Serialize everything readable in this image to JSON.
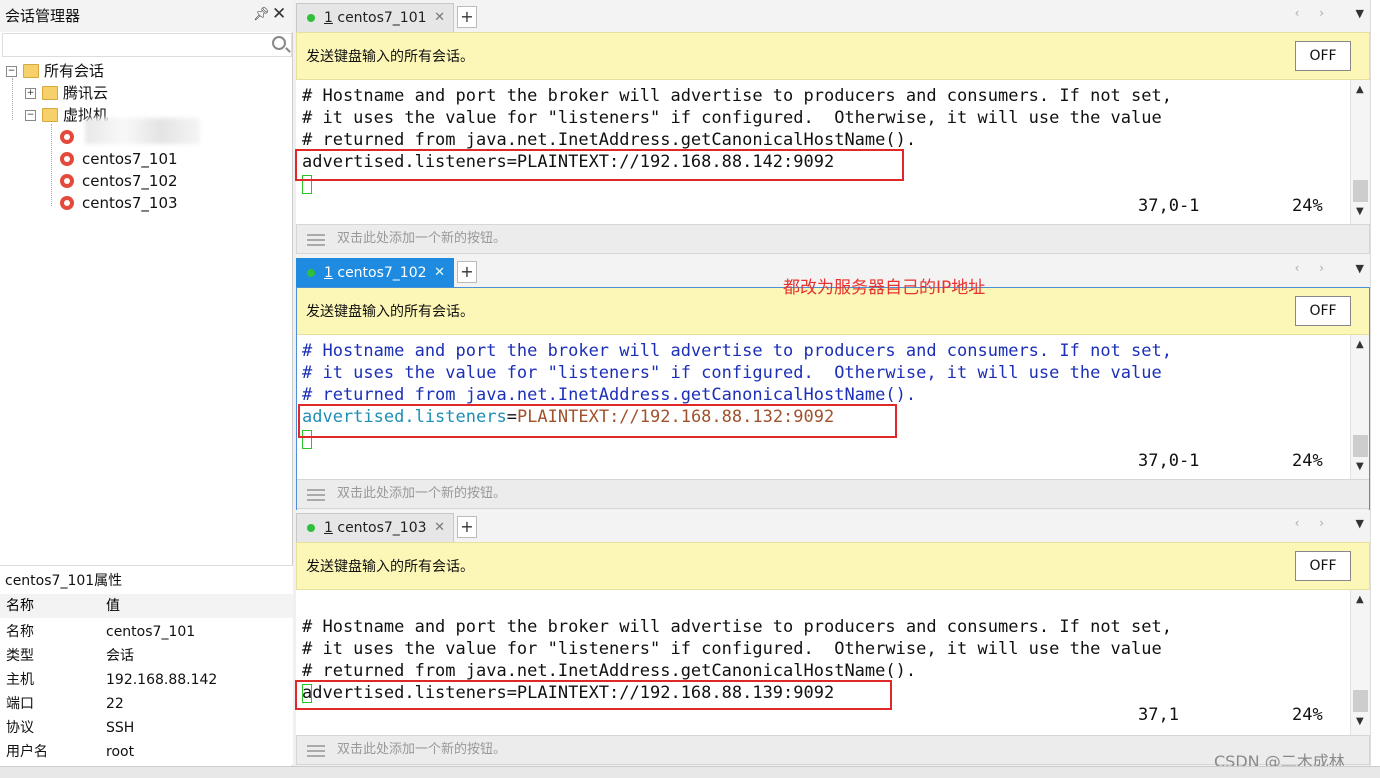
{
  "session_manager": {
    "title": "会话管理器",
    "search_placeholder": "",
    "tree": {
      "root_label": "所有会话",
      "folder1_label": "腾讯云",
      "folder2_label": "虚拟机",
      "sessions": [
        "centos7_101",
        "centos7_102",
        "centos7_103"
      ]
    }
  },
  "properties": {
    "title": "centos7_101属性",
    "col_name": "名称",
    "col_value": "值",
    "rows": [
      {
        "key": "名称",
        "value": "centos7_101"
      },
      {
        "key": "类型",
        "value": "会话"
      },
      {
        "key": "主机",
        "value": "192.168.88.142"
      },
      {
        "key": "端口",
        "value": "22"
      },
      {
        "key": "协议",
        "value": "SSH"
      },
      {
        "key": "用户名",
        "value": "root"
      }
    ]
  },
  "panes": [
    {
      "tab_num": "1",
      "tab_label": " centos7_101",
      "send_text": "发送键盘输入的所有会话。",
      "off_label": "OFF",
      "lines": [
        "# Hostname and port the broker will advertise to producers and consumers. If not set,",
        "# it uses the value for \"listeners\" if configured.  Otherwise, it will use the value",
        "# returned from java.net.InetAddress.getCanonicalHostName().",
        "advertised.listeners=PLAINTEXT://192.168.88.142:9092"
      ],
      "position": "37,0-1",
      "percent": "24%",
      "button_bar_hint": "双击此处添加一个新的按钮。"
    },
    {
      "tab_num": "1",
      "tab_label": " centos7_102",
      "send_text": "发送键盘输入的所有会话。",
      "off_label": "OFF",
      "lines": [
        "# Hostname and port the broker will advertise to producers and consumers. If not set,",
        "# it uses the value for \"listeners\" if configured.  Otherwise, it will use the value",
        "# returned from java.net.InetAddress.getCanonicalHostName()."
      ],
      "adv_key": "advertised.listeners",
      "adv_eq": "=",
      "adv_value": "PLAINTEXT://192.168.88.132:9092",
      "position": "37,0-1",
      "percent": "24%",
      "button_bar_hint": "双击此处添加一个新的按钮。"
    },
    {
      "tab_num": "1",
      "tab_label": " centos7_103",
      "send_text": "发送键盘输入的所有会话。",
      "off_label": "OFF",
      "lines": [
        "# Hostname and port the broker will advertise to producers and consumers. If not set,",
        "# it uses the value for \"listeners\" if configured.  Otherwise, it will use the value",
        "# returned from java.net.InetAddress.getCanonicalHostName().",
        "advertised.listeners=PLAINTEXT://192.168.88.139:9092"
      ],
      "position": "37,1",
      "percent": "24%",
      "button_bar_hint": "双击此处添加一个新的按钮。"
    }
  ],
  "annotation": "都改为服务器自己的IP地址",
  "watermark": "CSDN @二木成林",
  "colors": {
    "tab_active": "#1e8be0",
    "send_bar": "#fcf7b6",
    "highlight_box": "#e0282b",
    "annotation": "#e8322e",
    "comment_blue": "#1c2fb8"
  }
}
